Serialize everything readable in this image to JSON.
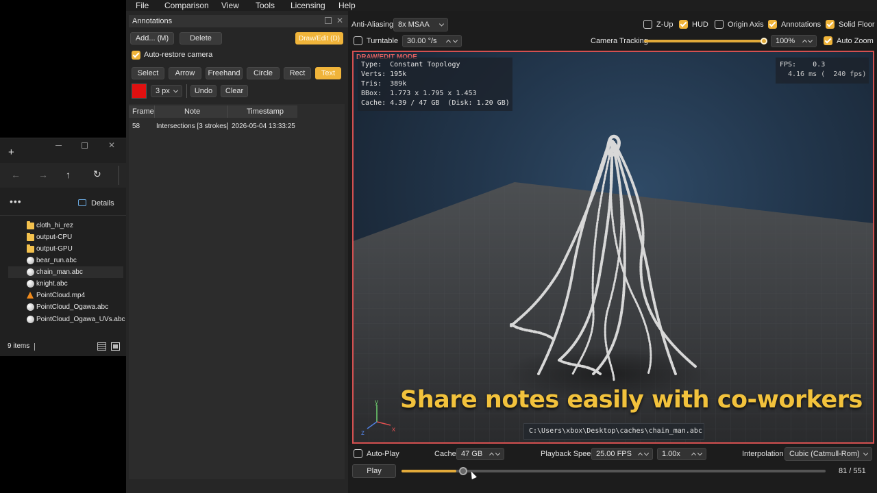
{
  "menu": [
    "File",
    "Comparison",
    "View",
    "Tools",
    "Licensing",
    "Help"
  ],
  "annotations_panel": {
    "title": "Annotations",
    "add_label": "Add... (M)",
    "delete_label": "Delete",
    "draw_edit_label": "Draw/Edit (D)",
    "auto_restore_label": "Auto-restore camera",
    "tools": [
      "Select",
      "Arrow",
      "Freehand",
      "Circle",
      "Rect",
      "Text"
    ],
    "active_tool": "Text",
    "brush_color": "#e01010",
    "brush_size": "3 px",
    "undo_label": "Undo",
    "clear_label": "Clear",
    "table": {
      "headers": [
        "Frame",
        "Note",
        "Timestamp"
      ],
      "rows": [
        {
          "frame": "58",
          "note": "Intersections [3 strokes]",
          "timestamp": "2026-05-04 13:33:25"
        }
      ]
    }
  },
  "toolbar": {
    "anti_aliasing_label": "Anti-Aliasing",
    "anti_aliasing_value": "8x MSAA",
    "turntable_label": "Turntable",
    "turntable_value": "30.00 °/s",
    "camera_tracking_label": "Camera Tracking",
    "camera_tracking_level": 1.0,
    "camera_tracking_value": "100%",
    "toggles": {
      "z_up": "Z-Up",
      "hud": "HUD",
      "origin_axis": "Origin Axis",
      "annotations": "Annotations",
      "solid_floor": "Solid Floor",
      "auto_zoom": "Auto Zoom"
    }
  },
  "viewport": {
    "mode_label": "DRAW/EDIT MODE",
    "stats": [
      "Type:  Constant Topology",
      "Verts: 195k",
      "Tris:  389k",
      "BBox:  1.773 x 1.795 x 1.453",
      "Cache: 4.39 / 47 GB  (Disk: 1.20 GB)"
    ],
    "fps_line1": "FPS:    0.3",
    "fps_line2": "4.16 ms (  240 fps)",
    "caption": "Share notes easily with co-workers",
    "file_path": "C:\\Users\\xbox\\Desktop\\caches\\chain_man.abc",
    "axis_labels": {
      "x": "x",
      "y": "y",
      "z": "z"
    },
    "colors": {
      "mode_border": "#d45050",
      "caption": "#f2c23c"
    }
  },
  "playback": {
    "auto_play_label": "Auto-Play",
    "cache_label": "Cache",
    "cache_value": "47 GB",
    "playback_speed_label": "Playback Speed",
    "playback_speed_value": "25.00 FPS",
    "speed_multiplier": "1.00x",
    "interpolation_label": "Interpolation",
    "interpolation_value": "Cubic (Catmull-Rom)",
    "play_label": "Play",
    "frame_counter": "81 / 551",
    "current_frame": 81,
    "total_frames": 551,
    "cached_fraction": 0.13
  },
  "explorer": {
    "details_label": "Details",
    "items": [
      {
        "name": "cloth_hi_rez",
        "icon": "folder-icon"
      },
      {
        "name": "output-CPU",
        "icon": "folder-icon"
      },
      {
        "name": "output-GPU",
        "icon": "folder-icon"
      },
      {
        "name": "bear_run.abc",
        "icon": "abc-file-icon"
      },
      {
        "name": "chain_man.abc",
        "icon": "abc-file-icon",
        "selected": true
      },
      {
        "name": "knight.abc",
        "icon": "abc-file-icon"
      },
      {
        "name": "PointCloud.mp4",
        "icon": "vlc-file-icon"
      },
      {
        "name": "PointCloud_Ogawa.abc",
        "icon": "abc-file-icon"
      },
      {
        "name": "PointCloud_Ogawa_UVs.abc",
        "icon": "abc-file-icon"
      }
    ],
    "status": "9 items"
  }
}
